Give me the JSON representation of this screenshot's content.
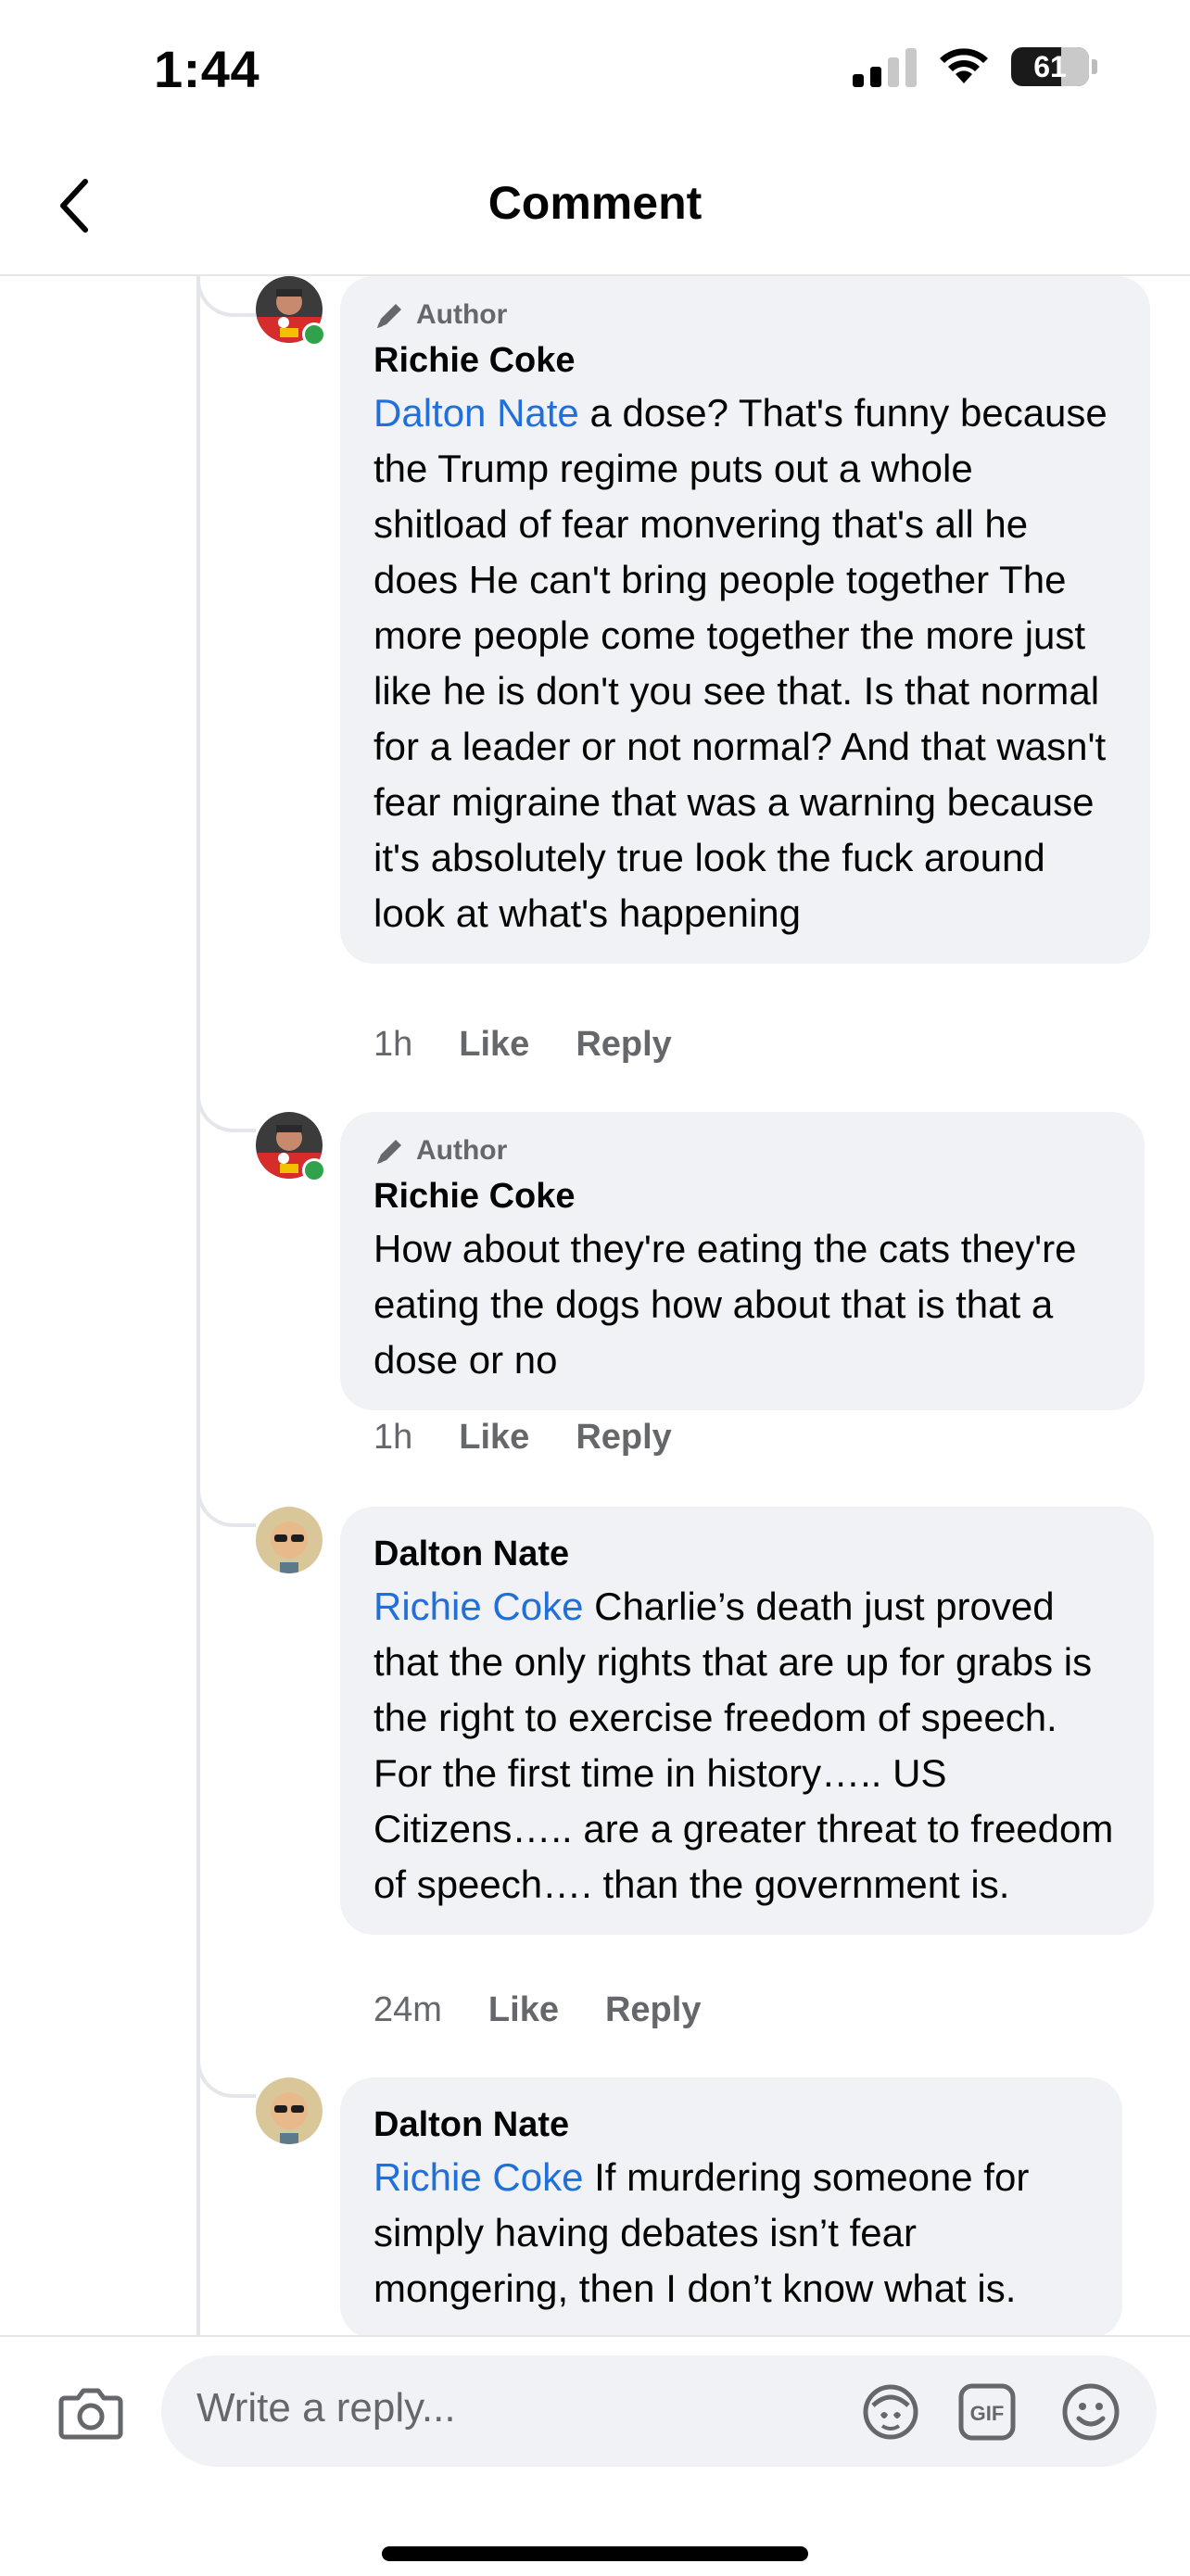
{
  "status_bar": {
    "time": "1:44",
    "battery": "61"
  },
  "header": {
    "title": "Comment"
  },
  "comments": [
    {
      "badge": "Author",
      "author": "Richie Coke",
      "mention": "Dalton Nate",
      "text": " a dose? That's funny because the Trump regime puts out a whole shitload of fear monvering that's all he does He can't bring people together The more people come together the more just like he is don't you see that. Is that normal for a leader or not normal? And that wasn't fear migraine that was a warning because it's absolutely true look the fuck around look at what's happening",
      "time": "1h",
      "like": "Like",
      "reply": "Reply"
    },
    {
      "badge": "Author",
      "author": "Richie Coke",
      "mention": "",
      "text": "How about they're eating the cats they're eating the dogs how about that is that a dose or no",
      "time": "1h",
      "like": "Like",
      "reply": "Reply"
    },
    {
      "badge": "",
      "author": "Dalton Nate",
      "mention": "Richie Coke",
      "text": " Charlie’s death just proved that the only rights that are up for grabs is the right to exercise freedom of speech.  For the first time in history….. US Citizens….. are a greater threat to freedom of speech…. than the government is.",
      "time": "24m",
      "like": "Like",
      "reply": "Reply"
    },
    {
      "badge": "",
      "author": "Dalton Nate",
      "mention": "Richie Coke",
      "text": " If murdering someone for simply having debates isn’t fear mongering, then I don’t know what is.",
      "time": "",
      "like": "",
      "reply": ""
    }
  ],
  "composer": {
    "placeholder": "Write a reply..."
  },
  "icons": [
    "back-chevron-icon",
    "pencil-icon",
    "camera-icon",
    "avatar-sticker-icon",
    "gif-icon",
    "emoji-icon"
  ],
  "colors": {
    "mention": "#216fdb",
    "bubble": "#f0f2f5",
    "online": "#31a24c"
  }
}
